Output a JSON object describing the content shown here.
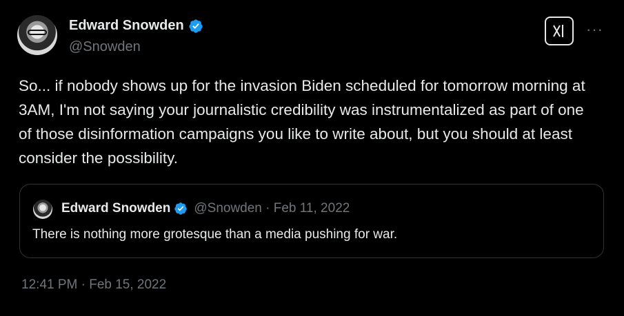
{
  "author": {
    "display_name": "Edward Snowden",
    "handle": "@Snowden"
  },
  "icons": {
    "verified": "verified-badge-icon",
    "grok": "grok-icon",
    "more": "more-options-icon"
  },
  "colors": {
    "verified_blue": "#1d9bf0",
    "secondary_text": "#71767b",
    "primary_text": "#e7e9ea"
  },
  "tweet": {
    "text": "So... if nobody shows up for the invasion Biden scheduled for tomorrow morning at 3AM, I'm not saying your journalistic credibility was instrumentalized as part of one of those disinformation campaigns you like to write about, but you should at least consider the possibility.",
    "timestamp": "12:41 PM · Feb 15, 2022"
  },
  "quoted_tweet": {
    "display_name": "Edward Snowden",
    "handle_date": "@Snowden · Feb 11, 2022",
    "text": "There is nothing more grotesque than a media pushing for war."
  },
  "more_label": "···"
}
